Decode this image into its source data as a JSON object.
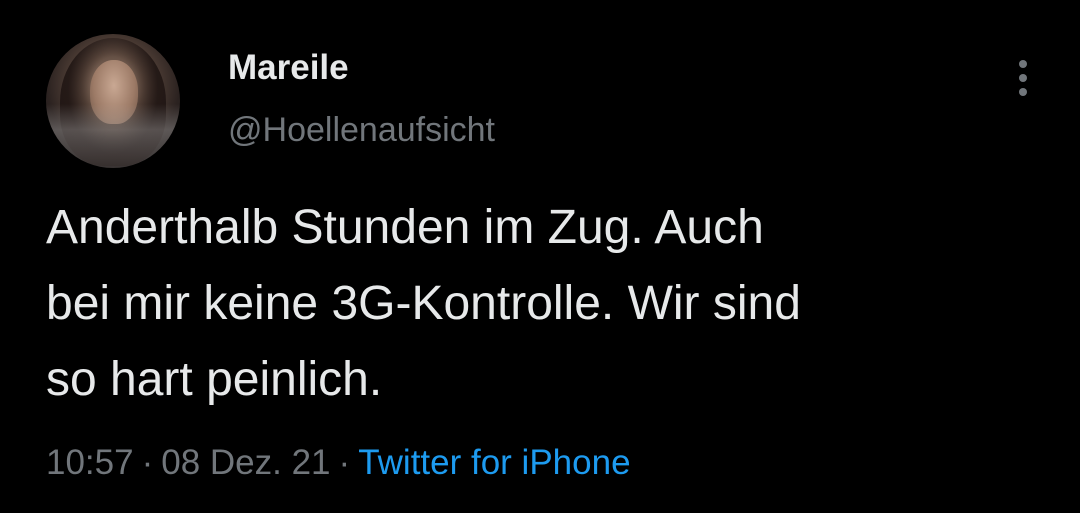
{
  "author": {
    "display_name": "Mareile",
    "handle": "@Hoellenaufsicht"
  },
  "tweet": {
    "text_lines": [
      "Anderthalb Stunden im Zug. Auch",
      "bei mir keine 3G-Kontrolle. Wir sind",
      "so hart peinlich."
    ],
    "time": "10:57",
    "date": "08 Dez. 21",
    "separator": "·",
    "source": "Twitter for iPhone"
  },
  "icons": {
    "more": "more-vertical-icon"
  },
  "colors": {
    "background": "#000000",
    "text": "#e7e9ea",
    "secondary": "#71767b",
    "link": "#1d9bf0"
  }
}
